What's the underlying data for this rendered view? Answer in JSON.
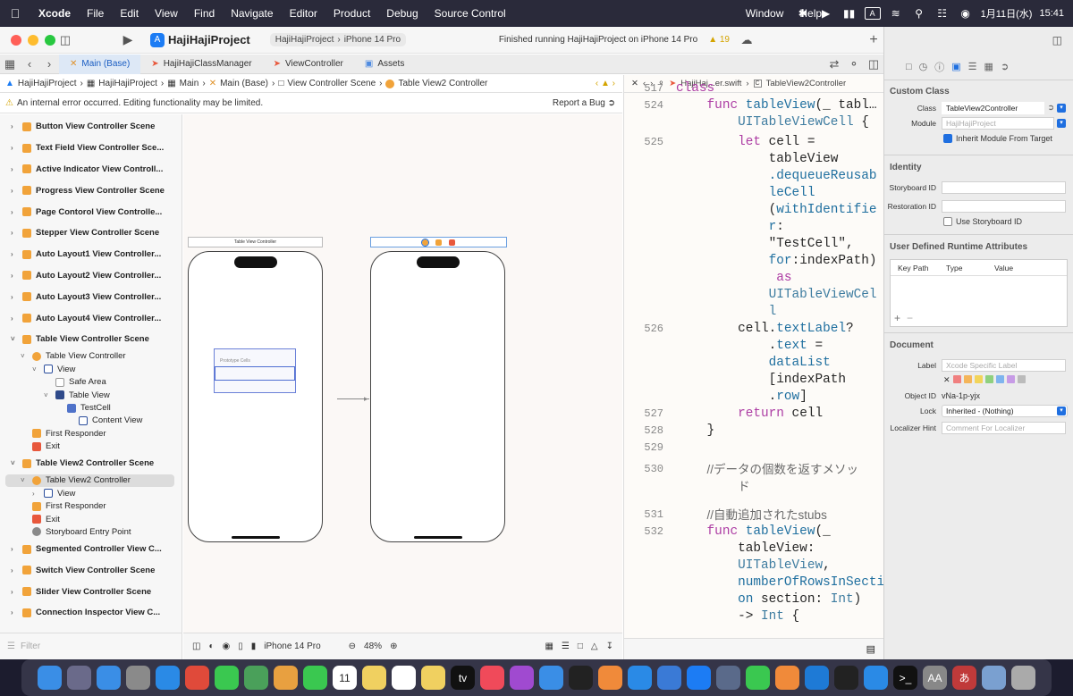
{
  "menubar": {
    "app": "Xcode",
    "items": [
      "File",
      "Edit",
      "View",
      "Find",
      "Navigate",
      "Editor",
      "Product",
      "Debug",
      "Source Control"
    ],
    "items_right": [
      "Window",
      "Help"
    ],
    "input_mode": "A",
    "date": "1月11日(水)",
    "time": "15:41"
  },
  "toolbar": {
    "project": "HajiHajiProject",
    "scheme": "HajiHajiProject",
    "device": "iPhone 14 Pro",
    "status": "Finished running HajiHajiProject on iPhone 14 Pro",
    "warnings": "19"
  },
  "tabs": [
    {
      "label": "Main (Base)",
      "active": true
    },
    {
      "label": "HajiHajiClassManager",
      "active": false
    },
    {
      "label": "ViewController",
      "active": false
    },
    {
      "label": "Assets",
      "active": false
    }
  ],
  "breadcrumb": [
    "HajiHajiProject",
    "HajiHajiProject",
    "Main",
    "Main (Base)",
    "View Controller Scene",
    "Table View2 Controller"
  ],
  "error": {
    "message": "An internal error occurred. Editing functionality may be limited.",
    "report": "Report a Bug"
  },
  "outline": [
    {
      "label": "Button View Controller Scene",
      "kind": "scene",
      "indent": 0
    },
    {
      "label": "Text Field View Controller Sce...",
      "kind": "scene",
      "indent": 0
    },
    {
      "label": "Active Indicator View Controll...",
      "kind": "scene",
      "indent": 0
    },
    {
      "label": "Progress View Controller Scene",
      "kind": "scene",
      "indent": 0
    },
    {
      "label": "Page Contorol View Controlle...",
      "kind": "scene",
      "indent": 0
    },
    {
      "label": "Stepper View Controller Scene",
      "kind": "scene",
      "indent": 0
    },
    {
      "label": "Auto Layout1 View Controller...",
      "kind": "scene",
      "indent": 0
    },
    {
      "label": "Auto Layout2 View Controller...",
      "kind": "scene",
      "indent": 0
    },
    {
      "label": "Auto Layout3 View Controller...",
      "kind": "scene",
      "indent": 0
    },
    {
      "label": "Auto Layout4 View Controller...",
      "kind": "scene",
      "indent": 0
    },
    {
      "label": "Table View Controller Scene",
      "kind": "scene-open",
      "indent": 0
    },
    {
      "label": "Table View Controller",
      "kind": "vc",
      "indent": 1
    },
    {
      "label": "View",
      "kind": "view",
      "indent": 2
    },
    {
      "label": "Safe Area",
      "kind": "safe",
      "indent": 3
    },
    {
      "label": "Table View",
      "kind": "table",
      "indent": 3
    },
    {
      "label": "TestCell",
      "kind": "cell",
      "indent": 4
    },
    {
      "label": "Content View",
      "kind": "view-leaf",
      "indent": 5
    },
    {
      "label": "First Responder",
      "kind": "responder",
      "indent": 1
    },
    {
      "label": "Exit",
      "kind": "exit",
      "indent": 1
    },
    {
      "label": "Table View2 Controller Scene",
      "kind": "scene-open",
      "indent": 0
    },
    {
      "label": "Table View2 Controller",
      "kind": "vc-sel",
      "indent": 1
    },
    {
      "label": "View",
      "kind": "view-closed",
      "indent": 2
    },
    {
      "label": "First Responder",
      "kind": "responder",
      "indent": 1
    },
    {
      "label": "Exit",
      "kind": "exit",
      "indent": 1
    },
    {
      "label": "Storyboard Entry Point",
      "kind": "entry",
      "indent": 1
    },
    {
      "label": "Segmented Controller View C...",
      "kind": "scene",
      "indent": 0
    },
    {
      "label": "Switch View Controller Scene",
      "kind": "scene",
      "indent": 0
    },
    {
      "label": "Slider View Controller Scene",
      "kind": "scene",
      "indent": 0
    },
    {
      "label": "Connection Inspector View C...",
      "kind": "scene",
      "indent": 0
    }
  ],
  "filter_placeholder": "Filter",
  "canvas": {
    "scene1_title": "Table View Controller",
    "prototype_label": "Prototype Cells",
    "device": "iPhone 14 Pro",
    "zoom": "48%"
  },
  "editor": {
    "crumb_file": "HajiHaj...er.swift",
    "crumb_class": "TableView2Controller"
  },
  "code": [
    {
      "n": "517",
      "parts": [
        [
          "kw",
          "class"
        ]
      ]
    },
    {
      "n": "524",
      "parts": [
        [
          "",
          "    "
        ],
        [
          "kw",
          "func"
        ],
        [
          "",
          " "
        ],
        [
          "fn",
          "tableView"
        ],
        [
          "",
          "(_ tabl…"
        ]
      ]
    },
    {
      "n": "",
      "parts": [
        [
          "",
          "        "
        ],
        [
          "ty",
          "UITableViewCell"
        ],
        [
          "",
          " {"
        ]
      ]
    },
    {
      "n": "525",
      "parts": [
        [
          "",
          "        "
        ],
        [
          "kw",
          "let"
        ],
        [
          "",
          " cell ="
        ]
      ]
    },
    {
      "n": "",
      "parts": [
        [
          "",
          "            tableView"
        ]
      ]
    },
    {
      "n": "",
      "parts": [
        [
          "",
          "            "
        ],
        [
          "fn",
          ".dequeueReusab"
        ]
      ]
    },
    {
      "n": "",
      "parts": [
        [
          "",
          "            "
        ],
        [
          "fn",
          "leCell"
        ]
      ]
    },
    {
      "n": "",
      "parts": [
        [
          "",
          "            ("
        ],
        [
          "fn",
          "withIdentifie"
        ]
      ]
    },
    {
      "n": "",
      "parts": [
        [
          "",
          "            "
        ],
        [
          "fn",
          "r"
        ],
        [
          "",
          ":"
        ]
      ]
    },
    {
      "n": "",
      "parts": [
        [
          "",
          "            \"TestCell\","
        ]
      ]
    },
    {
      "n": "",
      "parts": [
        [
          "",
          "            "
        ],
        [
          "fn",
          "for"
        ],
        [
          "",
          ":indexPath)"
        ]
      ]
    },
    {
      "n": "",
      "parts": [
        [
          "",
          "             "
        ],
        [
          "kw",
          "as"
        ]
      ]
    },
    {
      "n": "",
      "parts": [
        [
          "",
          "            "
        ],
        [
          "ty",
          "UITableViewCel"
        ]
      ]
    },
    {
      "n": "",
      "parts": [
        [
          "",
          "            "
        ],
        [
          "ty",
          "l"
        ]
      ]
    },
    {
      "n": "526",
      "parts": [
        [
          "",
          "        cell."
        ],
        [
          "fn",
          "textLabel"
        ],
        [
          "",
          "?"
        ]
      ]
    },
    {
      "n": "",
      "parts": [
        [
          "",
          "            ."
        ],
        [
          "fn",
          "text"
        ],
        [
          "",
          " ="
        ]
      ]
    },
    {
      "n": "",
      "parts": [
        [
          "",
          "            "
        ],
        [
          "fn",
          "dataList"
        ]
      ]
    },
    {
      "n": "",
      "parts": [
        [
          "",
          "            [indexPath"
        ]
      ]
    },
    {
      "n": "",
      "parts": [
        [
          "",
          "            ."
        ],
        [
          "fn",
          "row"
        ],
        [
          "",
          "]"
        ]
      ]
    },
    {
      "n": "527",
      "parts": [
        [
          "",
          "        "
        ],
        [
          "kw",
          "return"
        ],
        [
          "",
          " cell"
        ]
      ]
    },
    {
      "n": "528",
      "parts": [
        [
          "",
          "    }"
        ]
      ]
    },
    {
      "n": "529",
      "parts": [
        [
          "",
          ""
        ]
      ]
    },
    {
      "n": "530",
      "parts": [
        [
          "",
          "    "
        ],
        [
          "cm",
          "//データの個数を返すメソッ"
        ]
      ]
    },
    {
      "n": "",
      "parts": [
        [
          "",
          "        "
        ],
        [
          "cm",
          "ド"
        ]
      ]
    },
    {
      "n": "531",
      "parts": [
        [
          "",
          "    "
        ],
        [
          "cm",
          "//自動追加されたstubs"
        ]
      ]
    },
    {
      "n": "532",
      "parts": [
        [
          "",
          "    "
        ],
        [
          "kw",
          "func"
        ],
        [
          "",
          " "
        ],
        [
          "fn",
          "tableView"
        ],
        [
          "",
          "(_"
        ]
      ]
    },
    {
      "n": "",
      "parts": [
        [
          "",
          "        tableView:"
        ]
      ]
    },
    {
      "n": "",
      "parts": [
        [
          "",
          "        "
        ],
        [
          "ty",
          "UITableView"
        ],
        [
          "",
          ","
        ]
      ]
    },
    {
      "n": "",
      "parts": [
        [
          "",
          "        "
        ],
        [
          "fn",
          "numberOfRowsInSecti"
        ]
      ]
    },
    {
      "n": "",
      "parts": [
        [
          "",
          "        "
        ],
        [
          "fn",
          "on"
        ],
        [
          "",
          " section: "
        ],
        [
          "ty",
          "Int"
        ],
        [
          "",
          ")"
        ]
      ]
    },
    {
      "n": "",
      "parts": [
        [
          "",
          "        -> "
        ],
        [
          "ty",
          "Int"
        ],
        [
          "",
          " {"
        ]
      ]
    }
  ],
  "inspector": {
    "custom_class_title": "Custom Class",
    "class_label": "Class",
    "class_value": "TableView2Controller",
    "module_label": "Module",
    "module_placeholder": "HajiHajiProject",
    "inherit_label": "Inherit Module From Target",
    "identity_title": "Identity",
    "storyboard_id_label": "Storyboard ID",
    "restoration_id_label": "Restoration ID",
    "use_storyboard_id": "Use Storyboard ID",
    "udra_title": "User Defined Runtime Attributes",
    "udra_cols": [
      "Key Path",
      "Type",
      "Value"
    ],
    "document_title": "Document",
    "label_label": "Label",
    "label_placeholder": "Xcode Specific Label",
    "object_id_label": "Object ID",
    "object_id_value": "vNa-1p-yjx",
    "lock_label": "Lock",
    "lock_value": "Inherited - (Nothing)",
    "loc_hint_label": "Localizer Hint",
    "loc_hint_placeholder": "Comment For Localizer"
  },
  "colors": {
    "accent": "#1f6fe0",
    "scene_orange": "#f1a33a",
    "exit_red": "#e8583c",
    "label_swatches": [
      "#f08080",
      "#f4b55a",
      "#f2d45a",
      "#8fd07e",
      "#7fb4ee",
      "#c79be6",
      "#bbbbbb"
    ]
  },
  "dock": [
    "finder",
    "launchpad",
    "mail",
    "settings",
    "safari",
    "chrome",
    "messages",
    "maps",
    "photos",
    "facetime",
    "calendar",
    "notes-app",
    "reminders",
    "notes",
    "tv",
    "music",
    "podcasts",
    "testflight",
    "stocks",
    "pages",
    "appstore",
    "keynote",
    "xcode",
    "instruments",
    "numbers",
    "books",
    "vscode",
    "cloud",
    "zoom",
    "terminal",
    "font-book",
    "kotoeri",
    "preview",
    "trash"
  ],
  "dock_calendar_day": "11"
}
